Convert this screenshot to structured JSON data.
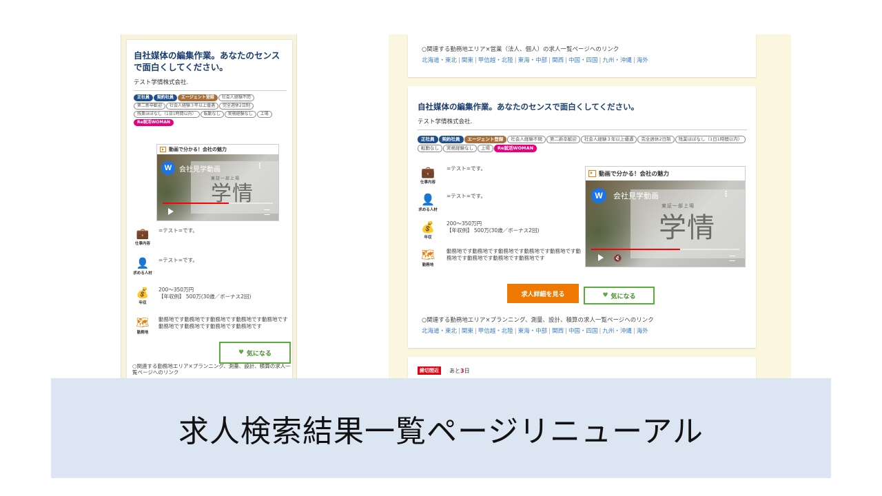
{
  "job": {
    "title": "自社媒体の編集作業。あなたのセンスで面白くしてください。",
    "company": "テスト学情株式会社.",
    "tags": [
      {
        "label": "正社員",
        "style": "navy"
      },
      {
        "label": "契約社員",
        "style": "navy"
      },
      {
        "label": "エージェント登録",
        "style": "brown"
      },
      {
        "label": "社会人経験不問",
        "style": "outline"
      },
      {
        "label": "第二新卒歓迎",
        "style": "outline"
      },
      {
        "label": "社会人経験３年以上優遇",
        "style": "outline"
      },
      {
        "label": "完全週休2日制",
        "style": "outline"
      },
      {
        "label": "残業ほぼなし（1日1時間以内）",
        "style": "outline"
      },
      {
        "label": "転勤なし",
        "style": "outline"
      },
      {
        "label": "実務経験なし",
        "style": "outline"
      },
      {
        "label": "上場",
        "style": "outline"
      },
      {
        "label": "Re就活WOMAN",
        "style": "pink"
      }
    ],
    "video": {
      "heading": "動画で分かる！会社の魅力",
      "channel_initial": "W",
      "player_title": "会社見学動画",
      "sign_small": "東証一部上場",
      "sign_big": "学情",
      "progress": 0.6
    },
    "info": [
      {
        "icon": "briefcase-icon",
        "symbol": "💼",
        "label": "仕事内容",
        "text": "=テスト=です。"
      },
      {
        "icon": "person-icon",
        "symbol": "👤",
        "label": "求める人材",
        "text": "=テスト=です。"
      },
      {
        "icon": "money-bag-icon",
        "symbol": "💰",
        "label": "年収",
        "text": "200〜350万円\n【年収例】 500万(30歳／ボーナス2回)"
      },
      {
        "icon": "map-pin-icon",
        "symbol": "🗺",
        "label": "勤務地",
        "text": "動務地です動務地です動務地です動務地です動務地です動務地です動務地です動務地です動務地です"
      }
    ],
    "detail_button": "求人詳細を見る",
    "favorite_button": "気になる"
  },
  "related_top": {
    "label": "○関連する勤務地エリア×営業（法人、個人）の求人一覧ページへのリンク"
  },
  "related_card": {
    "label": "○関連する勤務地エリア×プランニング、測量、設計、積算の求人一覧ページへのリンク"
  },
  "mobile_related_label": "○関連する勤務地エリア×プランニング、測量、設計、積算の求人一覧ページへのリンク",
  "regions": [
    "北海道・東北",
    "関東",
    "甲信越・北陸",
    "東海・中部",
    "関西",
    "中国・四国",
    "九州・沖縄",
    "海外"
  ],
  "next_card": {
    "deadline_badge": "締切間近",
    "remain_prefix": "あと",
    "remain_days": "3",
    "remain_suffix": "日"
  },
  "caption": "求人検索結果一覧ページリニューアル",
  "colors": {
    "title": "#1a3d6e",
    "accent_orange": "#ee7800",
    "favorite_green": "#5aab3c",
    "link_blue": "#3b7ec7",
    "tag_navy": "#1f4e8c",
    "tag_brown": "#a8703a",
    "tag_pink": "#e6007e",
    "banner_bg": "#dce6f2",
    "page_bg": "#fbf7de"
  }
}
